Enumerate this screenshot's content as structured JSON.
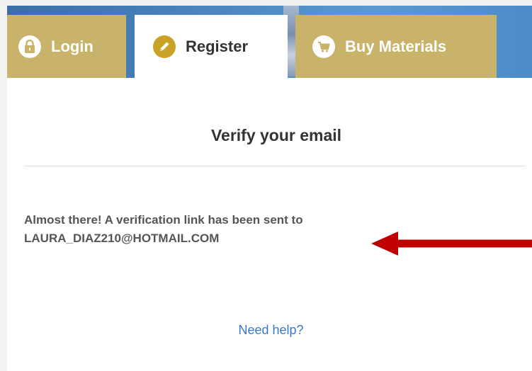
{
  "tabs": {
    "login": {
      "label": "Login",
      "icon": "lock-icon"
    },
    "register": {
      "label": "Register",
      "icon": "pencil-icon",
      "active": true
    },
    "buy": {
      "label": "Buy Materials",
      "icon": "cart-icon"
    }
  },
  "panel": {
    "title": "Verify your email",
    "message_line1": "Almost there! A verification link has been sent to",
    "email": "LAURA_DIAZ210@HOTMAIL.COM",
    "help_link": "Need help?"
  },
  "colors": {
    "tab_gold": "#c9b26a",
    "icon_gold": "#c9a227",
    "banner_blue": "#4c86c0",
    "link_blue": "#3a79c2",
    "arrow_red": "#c00000",
    "text_dark": "#333333",
    "text_grey": "#555555"
  }
}
